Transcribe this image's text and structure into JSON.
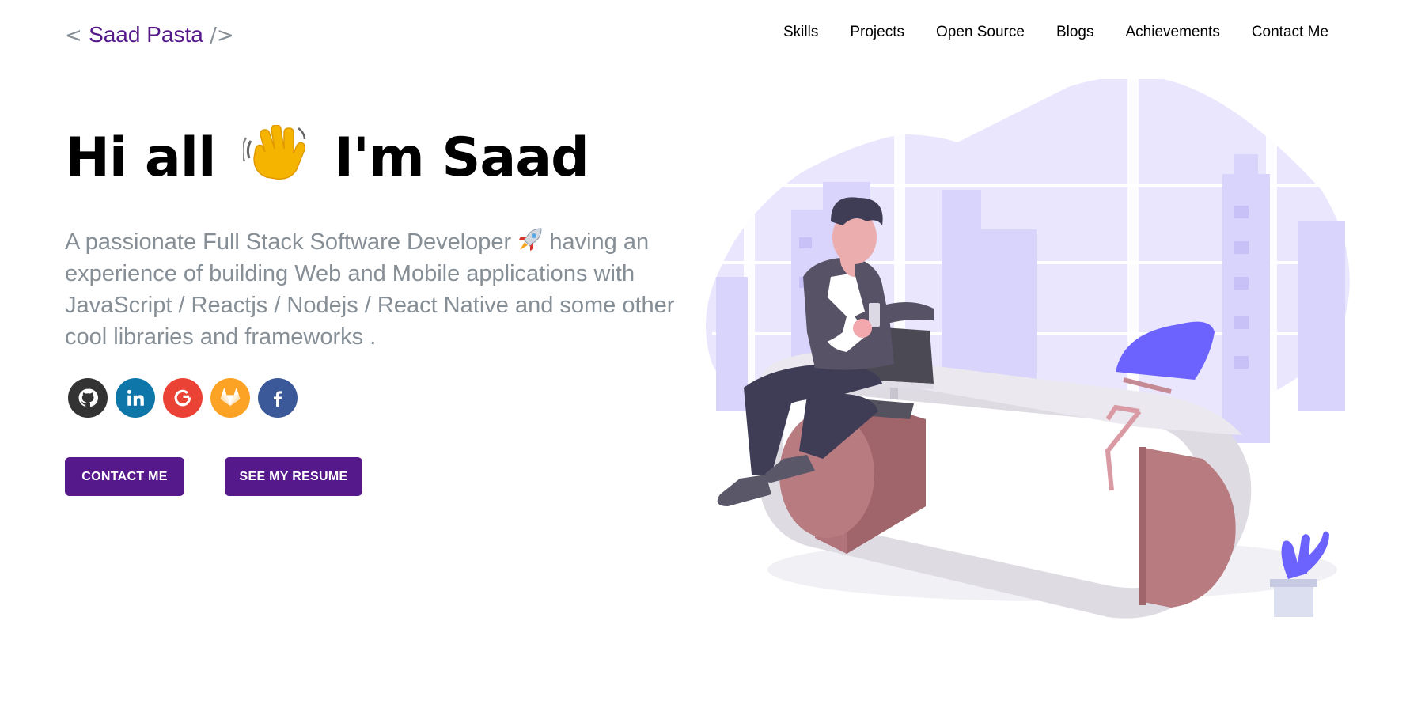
{
  "header": {
    "logo_open": "<",
    "logo_name": "Saad Pasta",
    "logo_close": "/>"
  },
  "nav": {
    "items": [
      "Skills",
      "Projects",
      "Open Source",
      "Blogs",
      "Achievements",
      "Contact Me"
    ]
  },
  "hero": {
    "greeting_before": "Hi all",
    "greeting_after": "I'm Saad",
    "subtitle_before": "A passionate Full Stack Software Developer",
    "subtitle_after": "having an experience of building Web and Mobile applications with JavaScript / Reactjs / Nodejs / React Native and some other cool libraries and frameworks ."
  },
  "socials": [
    {
      "name": "github-icon",
      "color": "#333333"
    },
    {
      "name": "linkedin-icon",
      "color": "#0e76a8"
    },
    {
      "name": "google-icon",
      "color": "#ea4335"
    },
    {
      "name": "gitlab-icon",
      "color": "#fca326"
    },
    {
      "name": "facebook-icon",
      "color": "#3b5998"
    }
  ],
  "buttons": {
    "contact": "CONTACT ME",
    "resume": "SEE MY RESUME"
  },
  "colors": {
    "accent": "#55198b",
    "muted_text": "#868e96",
    "illustration_purple": "#6c63ff"
  }
}
